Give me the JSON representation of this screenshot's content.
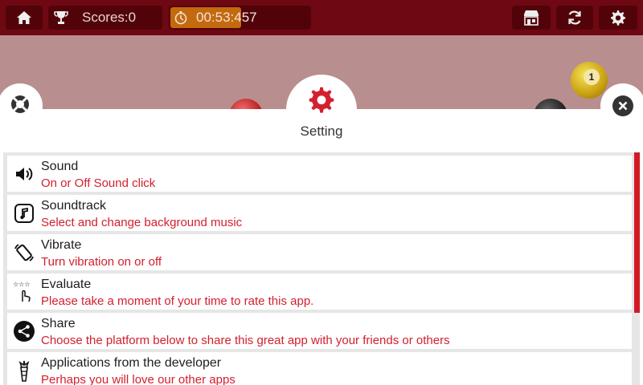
{
  "topbar": {
    "home_icon": "home-icon",
    "trophy_icon": "trophy-icon",
    "scores_label": "Scores:0",
    "timer_icon": "stopwatch-icon",
    "timer_value": "00:53:457",
    "shop_icon": "shop-icon",
    "refresh_icon": "refresh-icon",
    "settings_icon": "gear-icon"
  },
  "board": {
    "yellow_ball_number": "1"
  },
  "dialog": {
    "title": "Setting",
    "accent_color": "#d2202e",
    "items": [
      {
        "icon": "speaker-icon",
        "title": "Sound",
        "desc": "On or Off Sound click"
      },
      {
        "icon": "music-note-icon",
        "title": "Soundtrack",
        "desc": "Select and change background music"
      },
      {
        "icon": "vibrate-icon",
        "title": "Vibrate",
        "desc": "Turn vibration on or off"
      },
      {
        "icon": "rate-stars-icon",
        "title": "Evaluate",
        "desc": "Please take a moment of your time to rate this app."
      },
      {
        "icon": "share-icon",
        "title": "Share",
        "desc": "Choose the platform below to share this great app with your friends or others"
      },
      {
        "icon": "developer-icon",
        "title": "Applications from the developer",
        "desc": "Perhaps you will love our other apps"
      }
    ]
  }
}
